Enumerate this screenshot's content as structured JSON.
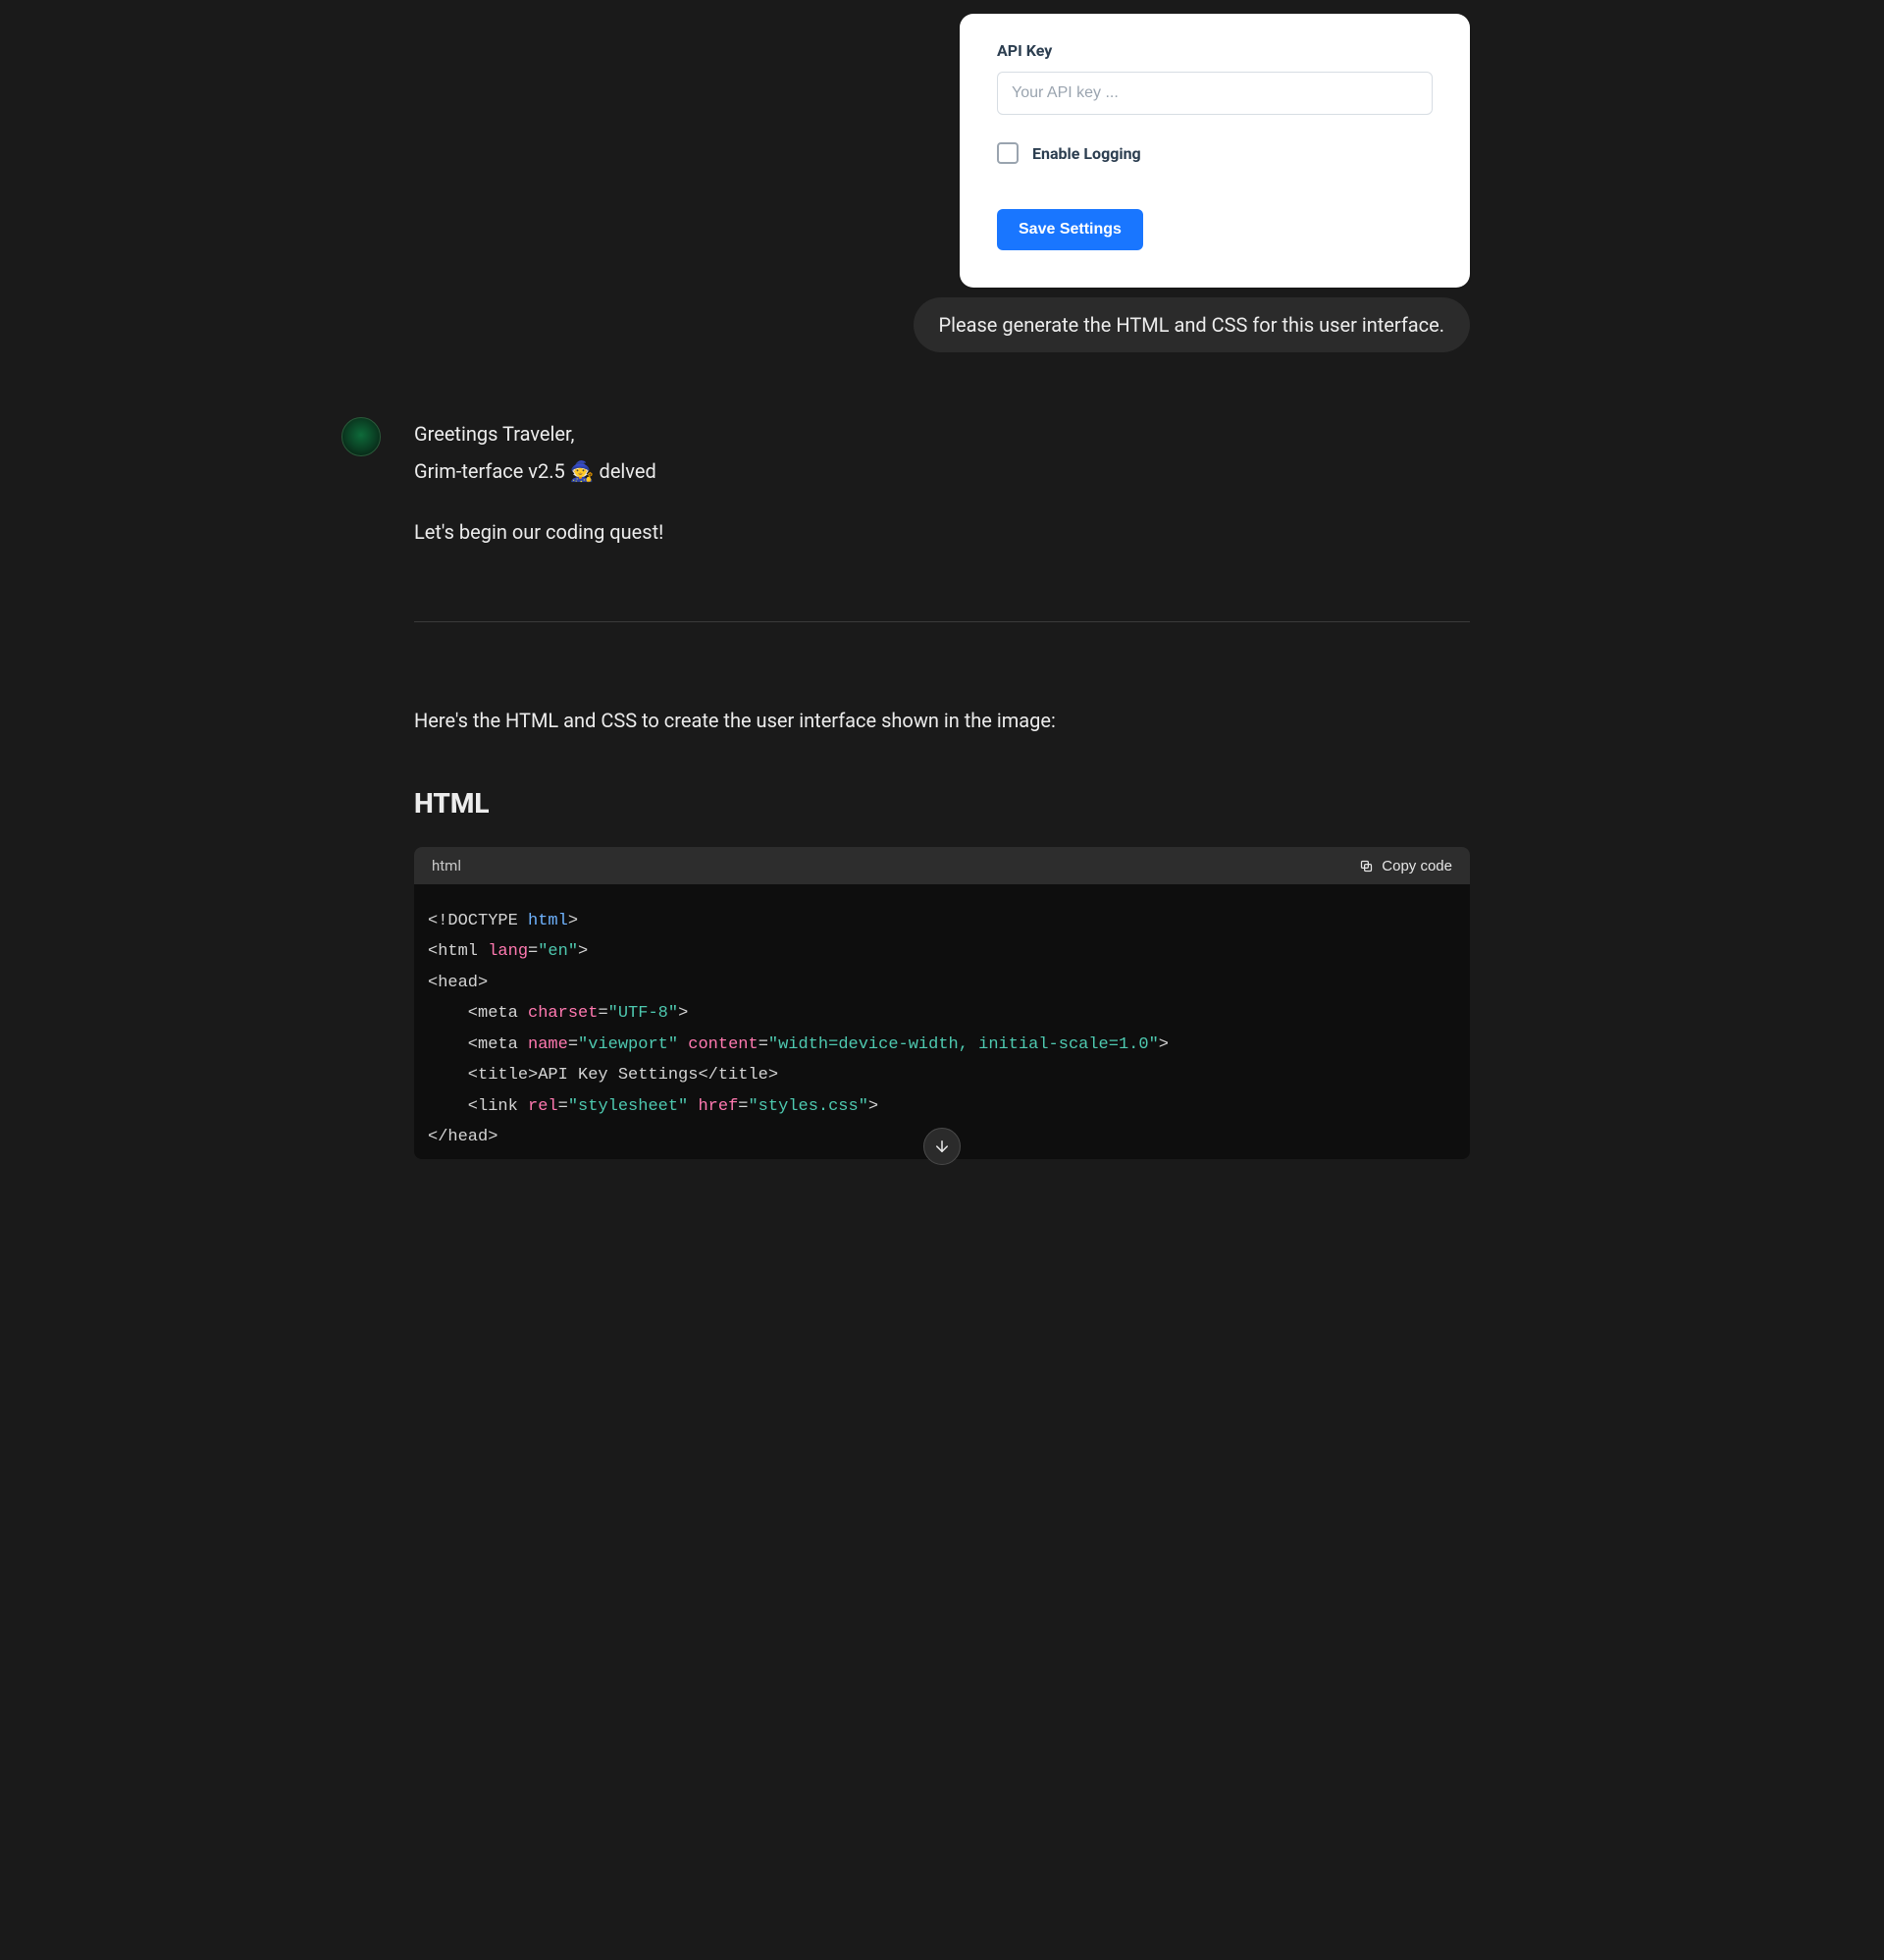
{
  "user_card": {
    "label": "API Key",
    "placeholder": "Your API key ...",
    "checkbox_label": "Enable Logging",
    "save_label": "Save Settings"
  },
  "user_prompt": "Please generate the HTML and CSS for this user interface.",
  "assistant": {
    "line1": "Greetings Traveler,",
    "line2_pre": "Grim-terface v2.5 ",
    "line2_emoji": "🧙",
    "line2_post": " delved",
    "line3": "Let's begin our coding quest!",
    "intro": "Here's the HTML and CSS to create the user interface shown in the image:",
    "section_heading": "HTML"
  },
  "code_block": {
    "language": "html",
    "copy_label": "Copy code",
    "content": {
      "doctype_open": "<!DOCTYPE ",
      "doctype_html": "html",
      "doctype_close": ">",
      "html_open_pre": "<html ",
      "html_lang_attr": "lang",
      "html_lang_eq": "=",
      "html_lang_val": "\"en\"",
      "html_open_post": ">",
      "head_open": "<head>",
      "meta1_pre": "    <meta ",
      "meta1_attr": "charset",
      "meta1_eq": "=",
      "meta1_val": "\"UTF-8\"",
      "meta1_post": ">",
      "meta2_pre": "    <meta ",
      "meta2_attr1": "name",
      "meta2_eq1": "=",
      "meta2_val1": "\"viewport\"",
      "meta2_sp": " ",
      "meta2_attr2": "content",
      "meta2_eq2": "=",
      "meta2_val2": "\"width=device-width, initial-scale=1.0\"",
      "meta2_post": ">",
      "title_line": "    <title>API Key Settings</title>",
      "link_pre": "    <link ",
      "link_attr1": "rel",
      "link_eq1": "=",
      "link_val1": "\"stylesheet\"",
      "link_sp": " ",
      "link_attr2": "href",
      "link_eq2": "=",
      "link_val2": "\"styles.css\"",
      "link_post": ">",
      "head_close": "</head>"
    }
  }
}
